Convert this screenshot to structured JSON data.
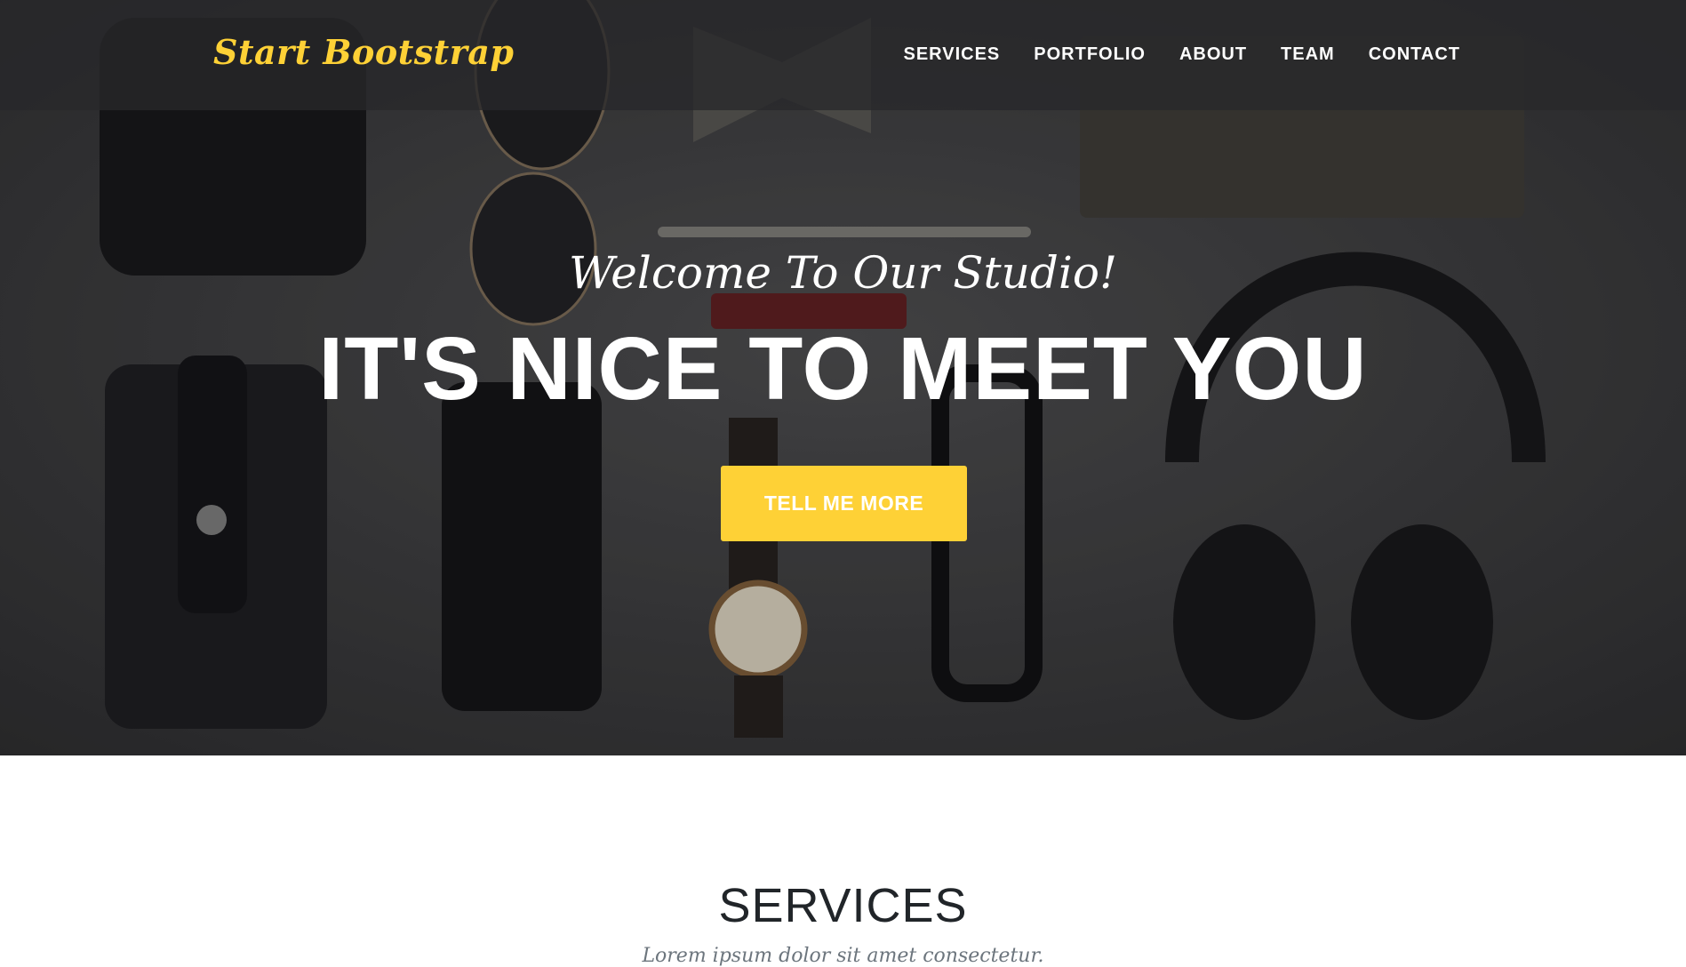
{
  "navbar": {
    "brand": "Start Bootstrap",
    "links": [
      "Services",
      "Portfolio",
      "About",
      "Team",
      "Contact"
    ]
  },
  "hero": {
    "lead": "Welcome To Our Studio!",
    "heading": "It's Nice To Meet You",
    "button_label": "Tell Me More"
  },
  "services": {
    "heading": "Services",
    "subheading": "Lorem ipsum dolor sit amet consectetur."
  },
  "colors": {
    "accent": "#fed136",
    "nav_background": "#28282a",
    "heading_text": "#212529",
    "muted_text": "#6c757d"
  }
}
